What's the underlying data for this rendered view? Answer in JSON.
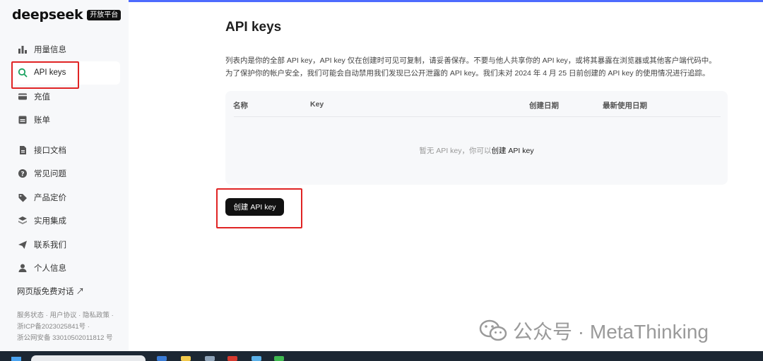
{
  "brand": {
    "name": "deepseek",
    "badge": "开放平台"
  },
  "sidebar": {
    "items": [
      {
        "label": "用量信息",
        "icon": "bar-chart-icon"
      },
      {
        "label": "API keys",
        "icon": "search-icon",
        "active": true
      },
      {
        "label": "充值",
        "icon": "card-icon"
      },
      {
        "label": "账单",
        "icon": "bill-icon"
      },
      {
        "label": "接口文档",
        "icon": "document-icon"
      },
      {
        "label": "常见问题",
        "icon": "question-icon"
      },
      {
        "label": "产品定价",
        "icon": "tag-icon"
      },
      {
        "label": "实用集成",
        "icon": "layers-icon"
      },
      {
        "label": "联系我们",
        "icon": "send-icon"
      },
      {
        "label": "个人信息",
        "icon": "user-icon"
      }
    ],
    "web_chat": "网页版免费对话 ↗",
    "footer": {
      "status": "服务状态",
      "agreement": "用户协议",
      "privacy": "隐私政策",
      "icp": "浙ICP备2023025841号 ·",
      "police": "浙公网安备 33010502011812 号"
    }
  },
  "main": {
    "title": "API keys",
    "desc_line1": "列表内是你的全部 API key，API key 仅在创建时可见可复制，请妥善保存。不要与他人共享你的 API key，或将其暴露在浏览器或其他客户端代码中。",
    "desc_line2": "为了保护你的帐户安全，我们可能会自动禁用我们发现已公开泄露的 API key。我们未对 2024 年 4 月 25 日前创建的 API key 的使用情况进行追踪。",
    "table": {
      "headers": [
        "名称",
        "Key",
        "创建日期",
        "最新使用日期"
      ],
      "empty_text": "暂无 API key，你可以",
      "empty_link": "创建 API key"
    },
    "create_button": "创建 API key"
  },
  "watermark": "公众号 · MetaThinking",
  "colors": {
    "accent": "#4d6bfe",
    "highlight": "#e02424",
    "button": "#111111"
  }
}
